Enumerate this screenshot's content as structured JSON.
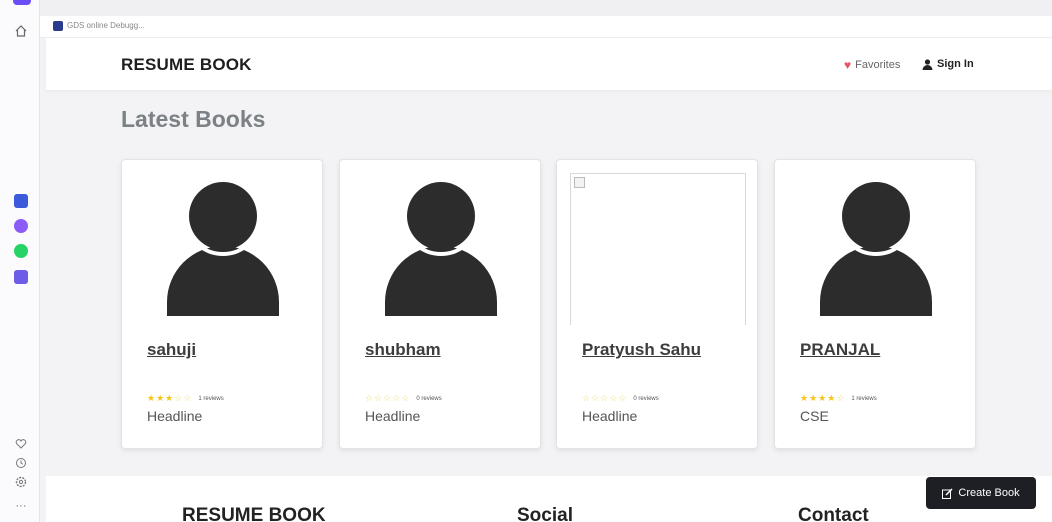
{
  "tab": {
    "title": "GDS online Debugg..."
  },
  "header": {
    "brand": "RESUME BOOK",
    "favorites": "Favorites",
    "sign_in": "Sign In"
  },
  "section": {
    "title": "Latest Books"
  },
  "cards": [
    {
      "name": "sahuji",
      "rating": 3,
      "reviews": "1 reviews",
      "subtitle": "Headline",
      "image": "avatar"
    },
    {
      "name": "shubham",
      "rating": 0,
      "reviews": "0 reviews",
      "subtitle": "Headline",
      "image": "avatar"
    },
    {
      "name": "Pratyush Sahu",
      "rating": 0,
      "reviews": "0 reviews",
      "subtitle": "Headline",
      "image": "broken"
    },
    {
      "name": "PRANJAL",
      "rating": 4,
      "reviews": "1 reviews",
      "subtitle": "CSE",
      "image": "avatar"
    }
  ],
  "footer": {
    "brand": "RESUME BOOK",
    "social": "Social",
    "contact": "Contact"
  },
  "create_button": {
    "label": "Create Book"
  },
  "colors": {
    "heart": "#e6556a",
    "star": "#f5c518",
    "button_bg": "#1d1f24",
    "browser_accent": "#6a4df4"
  },
  "icons": [
    "home-icon",
    "heart-icon",
    "history-icon",
    "settings-icon",
    "more-icon",
    "user-icon",
    "edit-icon"
  ]
}
